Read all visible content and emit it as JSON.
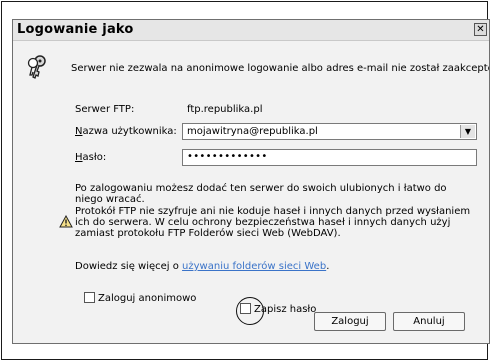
{
  "dialog": {
    "title": "Logowanie jako",
    "message": "Serwer nie zezwala na anonimowe logowanie albo adres e-mail nie został zaakceptowany.",
    "server_label": "Serwer FTP:",
    "server_value": "ftp.republika.pl",
    "username_label": "Nazwa użytkownika:",
    "username_value": "mojawitryna@republika.pl",
    "password_label": "Hasło:",
    "password_value": "•••••••••••••",
    "info_text": "Po zalogowaniu możesz dodać ten serwer do swoich ulubionych i łatwo do niego wracać.",
    "warning_text": "Protokół FTP nie szyfruje ani nie koduje haseł i innych danych przed wysłaniem ich do serwera. W celu ochrony bezpieczeństwa haseł i innych danych użyj zamiast protokołu FTP Folderów sieci Web (WebDAV).",
    "more_prefix": "Dowiedz się więcej o ",
    "more_link": "używaniu folderów sieci Web",
    "more_suffix": ".",
    "anon_checkbox": "Zaloguj anonimowo",
    "save_checkbox": "Zapisz hasło",
    "login_button": "Zaloguj",
    "cancel_button": "Anuluj"
  }
}
